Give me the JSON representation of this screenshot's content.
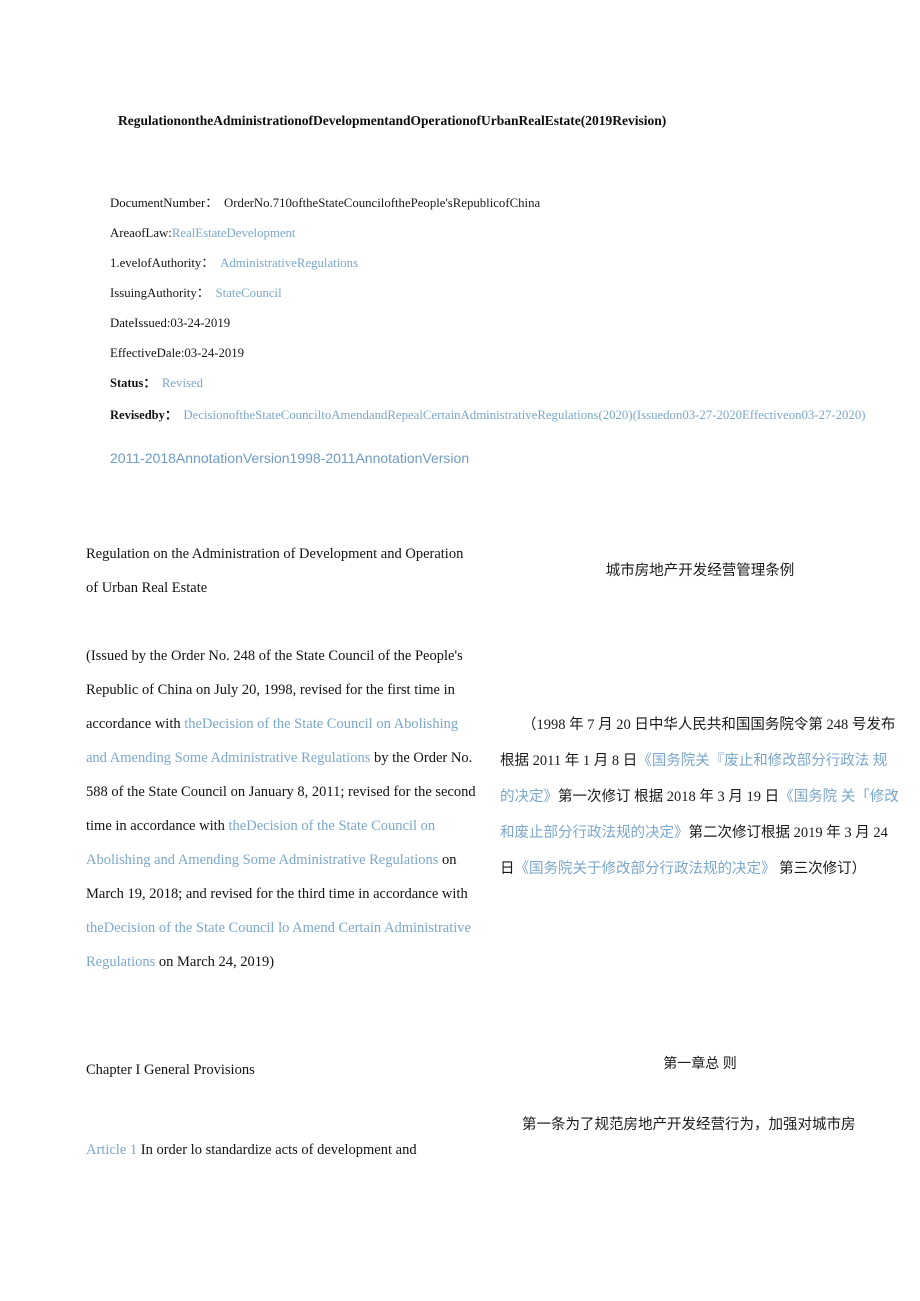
{
  "document": {
    "title": "RegulationontheAdministrationofDevelopmentandOperationofUrbanRealEstate(2019Revision)"
  },
  "metadata": {
    "document_number": {
      "label": "DocumentNumber：",
      "value": "OrderNo.710oftheStateCouncilofthePeople'sRepublicofChina"
    },
    "area_of_law": {
      "label": "AreaofLaw:",
      "value": "RealEstateDevelopment"
    },
    "level_of_authority": {
      "label": "1.evelofAuthority：",
      "value": "AdministrativeRegulations"
    },
    "issuing_authority": {
      "label": "IssuingAuthority：",
      "value": "StateCouncil"
    },
    "date_issued": {
      "label": "DateIssued:",
      "value": "03-24-2019"
    },
    "effective_date": {
      "label": "EffectiveDale:",
      "value": "03-24-2019"
    },
    "status": {
      "label": "Status：",
      "value": "Revised"
    },
    "revised_by": {
      "label": "Revisedby：",
      "value": "DecisionoftheStateCounciltoAmendandRepealCertainAdministrativeRegulations(2020)(Issuedon03-27-2020Effectiveon03-27-2020)"
    },
    "annotation_versions": "2011-2018AnnotationVersion1998-2011AnnotationVersion"
  },
  "body": {
    "title_en": "Regulation on the Administration of Development and Operation of Urban Real Estate",
    "title_zh": "城市房地产开发经营管理条例",
    "issue_en_part1": "(Issued by the Order No. 248 of the State Council of the People's Republic of China on July 20, 1998, revised for the first time in accordance with ",
    "issue_en_link1": "theDecision of the State Council on Abolishing and Amending Some Administrative Regulations",
    "issue_en_part2": " by the Order No. 588 of the State Council on January 8, 2011; revised for the second time in accordance with ",
    "issue_en_link2": "theDecision of the State Council on Abolishing and Amending Some Administrative Regulations",
    "issue_en_part3": " on March 19, 2018; and revised for the third time in accordance with ",
    "issue_en_link3": "theDecision of the State Council lo Amend Certain Administrative Regulations",
    "issue_en_part4": " on March 24, 2019)",
    "issue_zh_part1": "（1998 年 7 月 20 日中华人民共和国国务院令第 248 号发布 根据 2011 年 1 月 8 日",
    "issue_zh_link1": "《国务院关『废止和修改部分行政法 规的决定》",
    "issue_zh_part2": "第一次修订 根据 2018 年 3 月 19 日",
    "issue_zh_link2": "《国务院 关「修改和废止部分行政法规的决定》",
    "issue_zh_part3": "第二次修订根据 2019 年 3 月 24 日",
    "issue_zh_link3": "《国务院关于修改部分行政法规的决定》",
    "issue_zh_part4": " 第三次修订）",
    "chapter_en": "Chapter I General Provisions",
    "chapter_zh": "第一章总 则",
    "article1_label": "Article 1",
    "article1_en": " In order lo standardize acts of development and",
    "article1_zh": "第一条为了规范房地产开发经营行为，加强对城市房"
  },
  "colors": {
    "link": "#7ba7cb",
    "text": "#111111",
    "background": "#ffffff"
  }
}
